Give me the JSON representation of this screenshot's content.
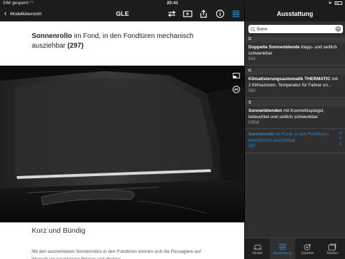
{
  "statusbar": {
    "carrier": "SIM gesperrt",
    "time": "20:41"
  },
  "nav": {
    "back_label": "Modellübersicht",
    "title": "GLE",
    "icons": [
      "share-icon",
      "video-icon",
      "export-icon",
      "info-icon",
      "list-icon"
    ]
  },
  "side_header": {
    "title": "Ausstattung"
  },
  "main": {
    "heading_bold": "Sonnenrollo",
    "heading_rest": " im Fond, in den Fondtüren mechanisch ausziehbar ",
    "heading_code": "(297)",
    "section_title": "Kurz und Bündig",
    "section_body": "Mit den ausziehbaren Sonnenrollos in den Fondtüren können sich die Passagiere auf Wunsch vor neugierigen Blicken und direkter"
  },
  "search": {
    "value": "Sonn",
    "placeholder": ""
  },
  "list": {
    "groups": [
      {
        "letter": "D"
      },
      {
        "letter": "K"
      },
      {
        "letter": "S"
      }
    ],
    "items": [
      {
        "bold": "Doppelte Sonnenblende",
        "rest": " klapp- und seitlich schwenkbar",
        "code": "543"
      },
      {
        "bold": "Klimatisierungsautomatik THERMATIC",
        "rest": " mit 2 Klimazonen, Temperatur für Fahrer un...",
        "code": "580"
      },
      {
        "bold": "Sonnenblenden",
        "rest": " mit Kosmetikspiegel, beleuchtet und seitlich schwenkbar",
        "code": "035W"
      },
      {
        "bold": "Sonnenrollo",
        "rest": " im Fond, in den Fondtüren mechanisch ausziehbar",
        "code": "297"
      }
    ],
    "index_letters": [
      "D",
      "K",
      "S"
    ]
  },
  "tabs": [
    {
      "label": "Modell",
      "icon": "car-icon"
    },
    {
      "label": "Ausstattung",
      "icon": "list-icon"
    },
    {
      "label": "Zubehör",
      "icon": "accessories-icon"
    },
    {
      "label": "Medien",
      "icon": "media-icon"
    }
  ],
  "colors": {
    "accent": "#1e90d8",
    "bar": "#1c1c1c",
    "panel": "#2f2f2f"
  }
}
